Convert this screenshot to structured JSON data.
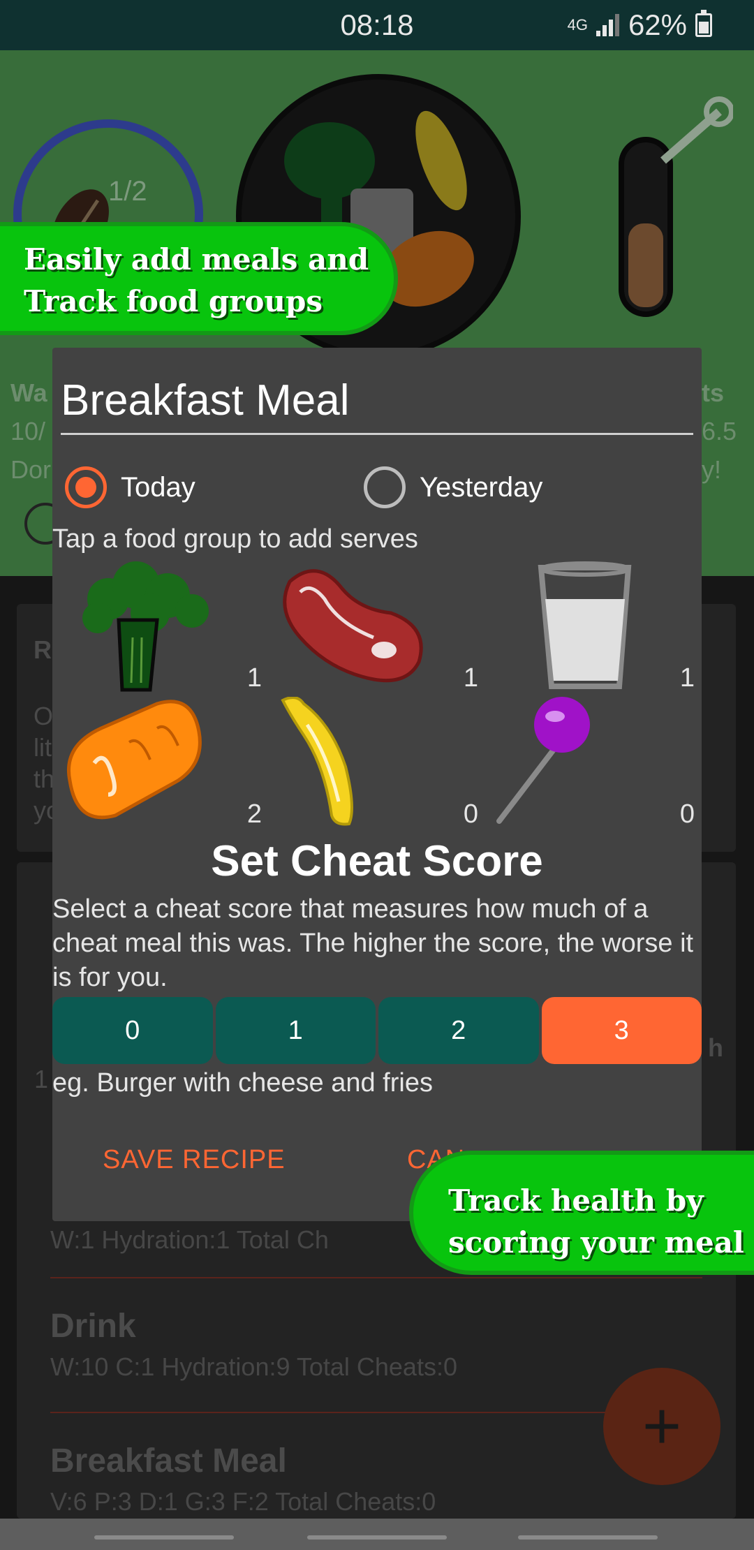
{
  "status_bar": {
    "time": "08:18",
    "network": "4G",
    "battery": "62%"
  },
  "background": {
    "water_progress": "1/2",
    "partial_texts": [
      "Wa",
      "10/",
      "Dor",
      "ts",
      "6.5",
      "y!",
      "R",
      "O",
      "lit",
      "th",
      "yo",
      "h",
      "1"
    ],
    "entries": [
      {
        "title": "",
        "stats": "W:1   Hydration:1   Total Ch"
      },
      {
        "title": "Drink",
        "stats": "W:10   C:1   Hydration:9   Total Cheats:0"
      },
      {
        "title": "Breakfast Meal",
        "stats": "V:6   P:3   D:1   G:3   F:2   Total Cheats:0"
      }
    ],
    "fab_label": "+"
  },
  "dialog": {
    "title": "Breakfast Meal",
    "day_options": [
      {
        "label": "Today",
        "checked": true
      },
      {
        "label": "Yesterday",
        "checked": false
      }
    ],
    "hint": "Tap a food group to add serves",
    "food_groups": [
      {
        "icon": "broccoli-icon",
        "count": "1"
      },
      {
        "icon": "steak-icon",
        "count": "1"
      },
      {
        "icon": "milk-glass-icon",
        "count": "1"
      },
      {
        "icon": "bread-icon",
        "count": "2"
      },
      {
        "icon": "banana-icon",
        "count": "0"
      },
      {
        "icon": "lollipop-icon",
        "count": "0"
      }
    ],
    "cheat_title": "Set Cheat Score",
    "cheat_description": "Select a cheat score that measures how much of a cheat meal this was. The higher the score, the worse it is for you.",
    "scores": [
      "0",
      "1",
      "2",
      "3"
    ],
    "selected_score": "3",
    "cheat_example": "eg. Burger with cheese and fries",
    "save_recipe": "SAVE RECIPE",
    "cancel": "CAN"
  },
  "banners": {
    "top": [
      "Easily add meals and",
      "Track food groups"
    ],
    "bottom": [
      "Track health by",
      "scoring your meal"
    ]
  },
  "colors": {
    "accent": "#ff6633",
    "score_button": "#0b5a52",
    "banner": "#08c40d",
    "header": "#386d3a"
  }
}
